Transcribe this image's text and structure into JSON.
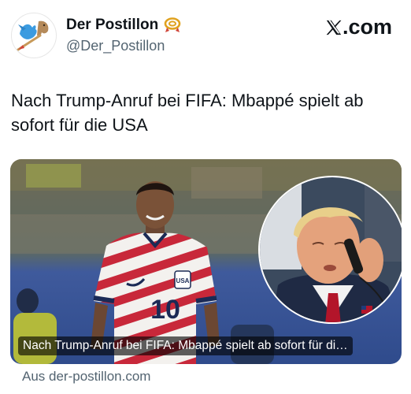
{
  "author": {
    "display_name": "Der Postillon",
    "handle": "@Der_Postillon",
    "avatar_icon": "postillon-bird-logo-icon",
    "badge_icon": "post-horn-icon"
  },
  "brand": {
    "label": ".com",
    "icon": "x-logo-icon"
  },
  "tweet": {
    "text": "Nach Trump-Anruf bei FIFA: Mbappé spielt ab sofort für die USA"
  },
  "link_card": {
    "image_icon": "soccer-player-and-phone-call-photo",
    "caption": "Nach Trump-Anruf bei FIFA: Mbappé spielt ab sofort für di…",
    "jersey_number": "10",
    "jersey_crest": "USA",
    "source": "Aus der-postillon.com"
  },
  "colors": {
    "text_primary": "#0f1419",
    "text_secondary": "#536471",
    "card_caption_bg": "#000000"
  }
}
